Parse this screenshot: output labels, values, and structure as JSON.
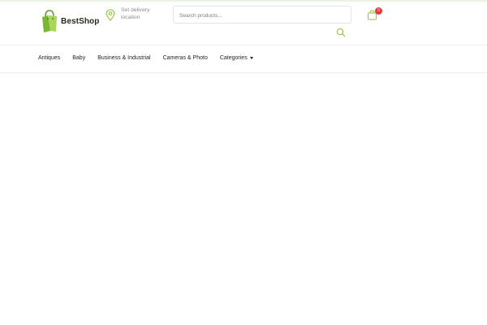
{
  "header": {
    "logo_text": "BestShop",
    "delivery": {
      "line1": "Set delivery",
      "line2": "location"
    },
    "search": {
      "placeholder": "Search products...",
      "value": ""
    },
    "cart": {
      "count": "0"
    }
  },
  "nav": {
    "items": [
      {
        "label": "Antiques"
      },
      {
        "label": "Baby"
      },
      {
        "label": "Business & Industrial"
      },
      {
        "label": "Cameras & Photo"
      },
      {
        "label": "Categories"
      }
    ]
  },
  "colors": {
    "accent": "#8cc63f",
    "badge": "#e03a3a",
    "text": "#222222",
    "muted": "#8a8a8a"
  },
  "icons": {
    "logo": "shopping-bag-logo",
    "delivery": "location-pin-icon",
    "search": "search-icon",
    "cart": "shopping-bag-icon",
    "dropdown": "caret-down-icon"
  }
}
